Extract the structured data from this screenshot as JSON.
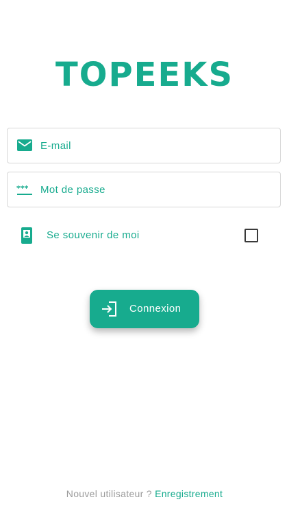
{
  "app": {
    "logo_text": "TOPEEKS"
  },
  "form": {
    "email": {
      "placeholder": "E-mail",
      "value": "",
      "icon": "mail-icon"
    },
    "password": {
      "placeholder": "Mot de passe",
      "value": "",
      "icon": "password-asterisk-icon"
    },
    "remember": {
      "label": "Se souvenir de moi",
      "checked": false,
      "icon": "phone-badge-icon"
    },
    "login_button": {
      "label": "Connexion",
      "icon": "login-icon"
    }
  },
  "footer": {
    "text": "Nouvel utilisateur ?",
    "link": "Enregistrement"
  },
  "colors": {
    "accent": "#17ab8e",
    "muted_text": "#9b9b9b",
    "border": "#d6d6d6"
  }
}
